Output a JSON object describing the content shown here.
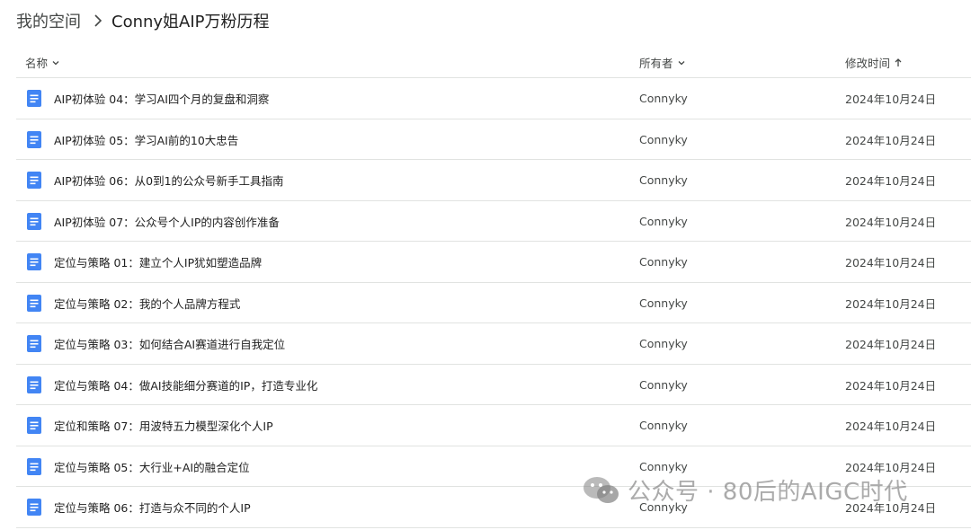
{
  "breadcrumb": {
    "root": "我的空间",
    "current": "Conny姐AIP万粉历程"
  },
  "header": {
    "name": "名称",
    "owner": "所有者",
    "modified": "修改时间"
  },
  "rows": [
    {
      "name": "AIP初体验 04：学习AI四个月的复盘和洞察",
      "owner": "Connyky",
      "modified": "2024年10月24日"
    },
    {
      "name": "AIP初体验 05：学习AI前的10大忠告",
      "owner": "Connyky",
      "modified": "2024年10月24日"
    },
    {
      "name": "AIP初体验 06：从0到1的公众号新手工具指南",
      "owner": "Connyky",
      "modified": "2024年10月24日"
    },
    {
      "name": "AIP初体验 07：公众号个人IP的内容创作准备",
      "owner": "Connyky",
      "modified": "2024年10月24日"
    },
    {
      "name": "定位与策略 01：建立个人IP犹如塑造品牌",
      "owner": "Connyky",
      "modified": "2024年10月24日"
    },
    {
      "name": "定位与策略 02：我的个人品牌方程式",
      "owner": "Connyky",
      "modified": "2024年10月24日"
    },
    {
      "name": "定位与策略 03：如何结合AI赛道进行自我定位",
      "owner": "Connyky",
      "modified": "2024年10月24日"
    },
    {
      "name": "定位与策略 04：做AI技能细分赛道的IP，打造专业化",
      "owner": "Connyky",
      "modified": "2024年10月24日"
    },
    {
      "name": "定位和策略 07：用波特五力模型深化个人IP",
      "owner": "Connyky",
      "modified": "2024年10月24日"
    },
    {
      "name": "定位与策略 05：大行业+AI的融合定位",
      "owner": "Connyky",
      "modified": "2024年10月24日"
    },
    {
      "name": "定位与策略 06：打造与众不同的个人IP",
      "owner": "Connyky",
      "modified": "2024年10月24日"
    }
  ],
  "watermark": {
    "text": "公众号 · 80后的AIGC时代"
  },
  "icons": {
    "breadcrumb_separator": "chevron-right-icon",
    "name_sort": "chevron-down-icon",
    "owner_filter": "chevron-down-icon",
    "modified_sort": "arrow-up-icon",
    "file": "google-doc-icon",
    "watermark": "wechat-icon"
  },
  "colors": {
    "doc_icon": "#4285f4",
    "divider": "#e1e3e1",
    "secondary_text": "#444746"
  }
}
